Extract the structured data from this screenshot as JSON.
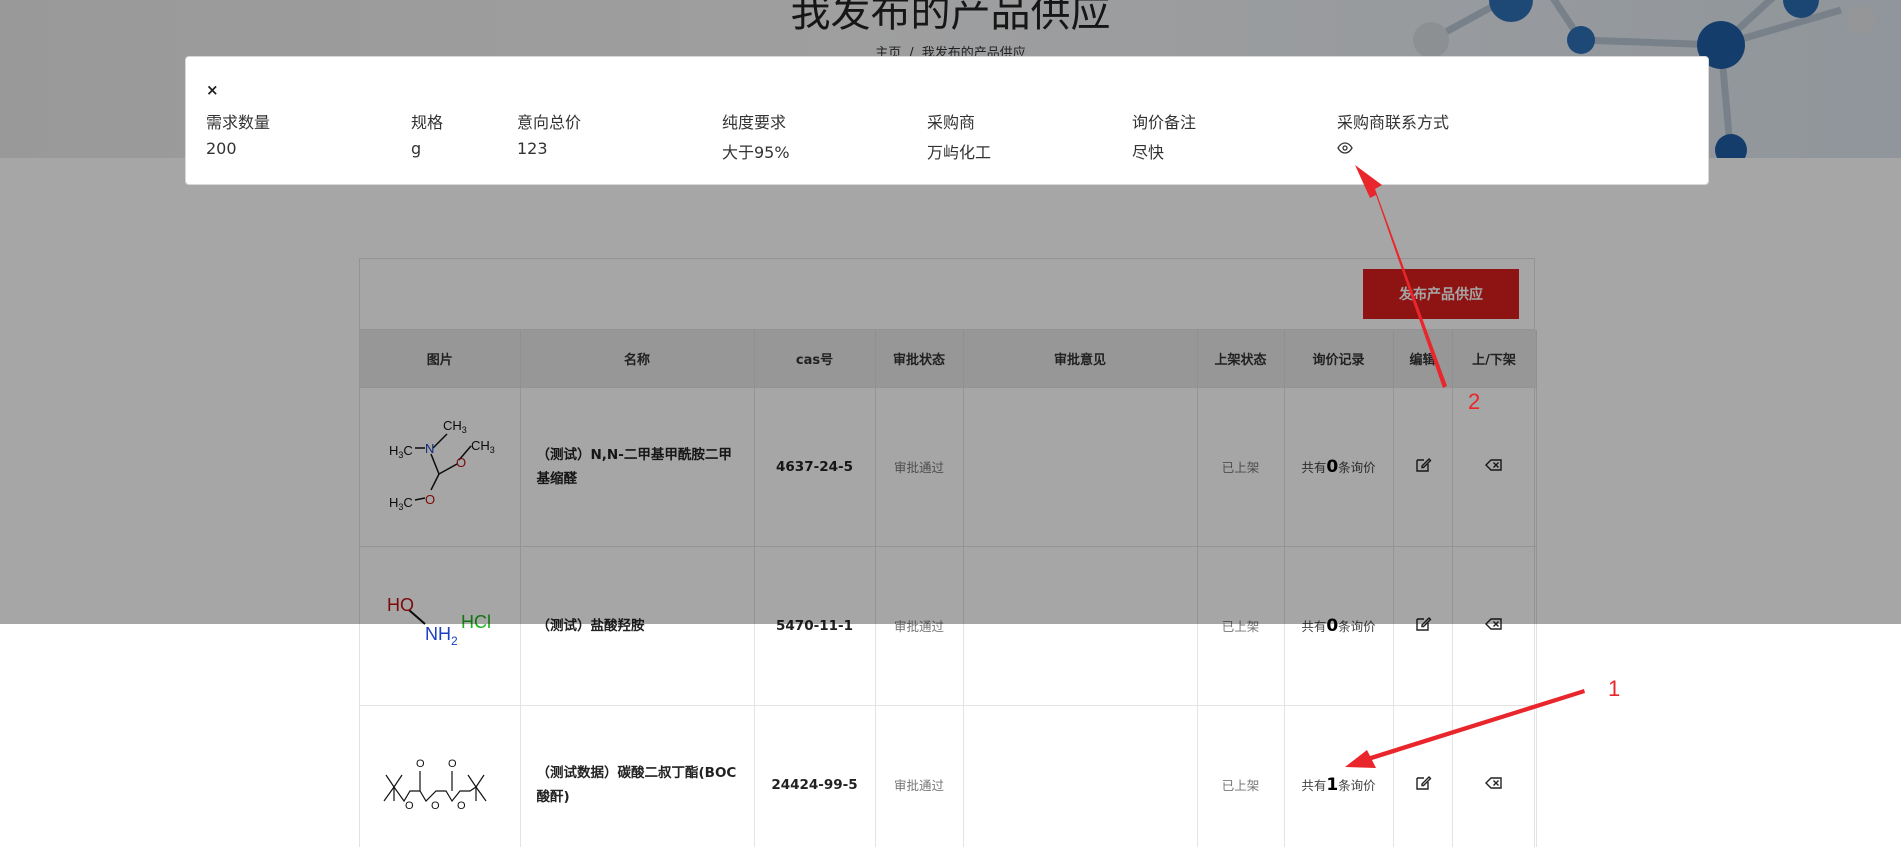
{
  "hero": {
    "title": "我发布的产品供应",
    "breadcrumb_home": "主页",
    "breadcrumb_sep": "/",
    "breadcrumb_current": "我发布的产品供应"
  },
  "toolbar": {
    "publish_label": "发布产品供应"
  },
  "table": {
    "headers": [
      "图片",
      "名称",
      "cas号",
      "审批状态",
      "审批意见",
      "上架状态",
      "询价记录",
      "编辑",
      "上/下架"
    ],
    "rows": [
      {
        "name": "（测试）N,N-二甲基甲酰胺二甲基缩醛",
        "cas": "4637-24-5",
        "approval": "审批通过",
        "opinion": "",
        "shelf": "已上架",
        "inq_prefix": "共有",
        "inq_count": "0",
        "inq_suffix": "条询价"
      },
      {
        "name": "（测试）盐酸羟胺",
        "cas": "5470-11-1",
        "approval": "审批通过",
        "opinion": "",
        "shelf": "已上架",
        "inq_prefix": "共有",
        "inq_count": "0",
        "inq_suffix": "条询价"
      },
      {
        "name": "（测试数据）碳酸二叔丁酯(BOC酸酐)",
        "cas": "24424-99-5",
        "approval": "审批通过",
        "opinion": "",
        "shelf": "已上架",
        "inq_prefix": "共有",
        "inq_count": "1",
        "inq_suffix": "条询价"
      }
    ]
  },
  "modal": {
    "close": "×",
    "columns": [
      {
        "label": "需求数量",
        "value": "200"
      },
      {
        "label": "规格",
        "value": "g"
      },
      {
        "label": "意向总价",
        "value": "123"
      },
      {
        "label": "纯度要求",
        "value": "大于95%"
      },
      {
        "label": "采购商",
        "value": "万屿化工"
      },
      {
        "label": "询价备注",
        "value": "尽快"
      },
      {
        "label": "采购商联系方式",
        "value": ""
      }
    ],
    "contact_icon": "eye-icon"
  },
  "annotations": {
    "label_1": "1",
    "label_2": "2",
    "color": "#e8262b"
  },
  "colors": {
    "accent": "#d9201e",
    "header_bg": "#e8e8e8"
  }
}
